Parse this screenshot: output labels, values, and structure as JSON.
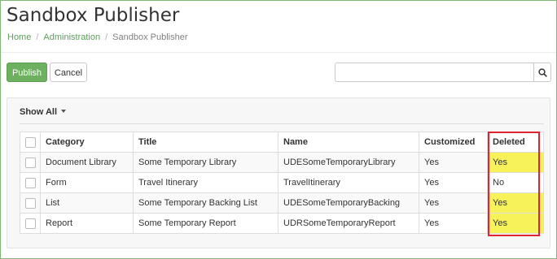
{
  "header": {
    "title": "Sandbox Publisher",
    "breadcrumb": [
      "Home",
      "Administration",
      "Sandbox Publisher"
    ]
  },
  "toolbar": {
    "publish_label": "Publish",
    "cancel_label": "Cancel",
    "search_value": "",
    "search_placeholder": ""
  },
  "filter": {
    "label": "Show All"
  },
  "table": {
    "columns": [
      "Category",
      "Title",
      "Name",
      "Customized",
      "Deleted"
    ],
    "rows": [
      {
        "category": "Document Library",
        "title": "Some Temporary Library",
        "name": "UDESomeTemporaryLibrary",
        "customized": "Yes",
        "deleted": "Yes"
      },
      {
        "category": "Form",
        "title": "Travel Itinerary",
        "name": "TravelItinerary",
        "customized": "Yes",
        "deleted": "No"
      },
      {
        "category": "List",
        "title": "Some Temporary Backing List",
        "name": "UDESomeTemporaryBacking",
        "customized": "Yes",
        "deleted": "Yes"
      },
      {
        "category": "Report",
        "title": "Some Temporary Report",
        "name": "UDRSomeTemporaryReport",
        "customized": "Yes",
        "deleted": "Yes"
      }
    ]
  },
  "colors": {
    "accent_green": "#6db160",
    "link_green": "#5aa05a",
    "highlight_yellow": "#f7f25a",
    "annotation_red": "#e0242f"
  },
  "icons": {
    "search": "search-icon",
    "dropdown": "caret-down-icon"
  }
}
